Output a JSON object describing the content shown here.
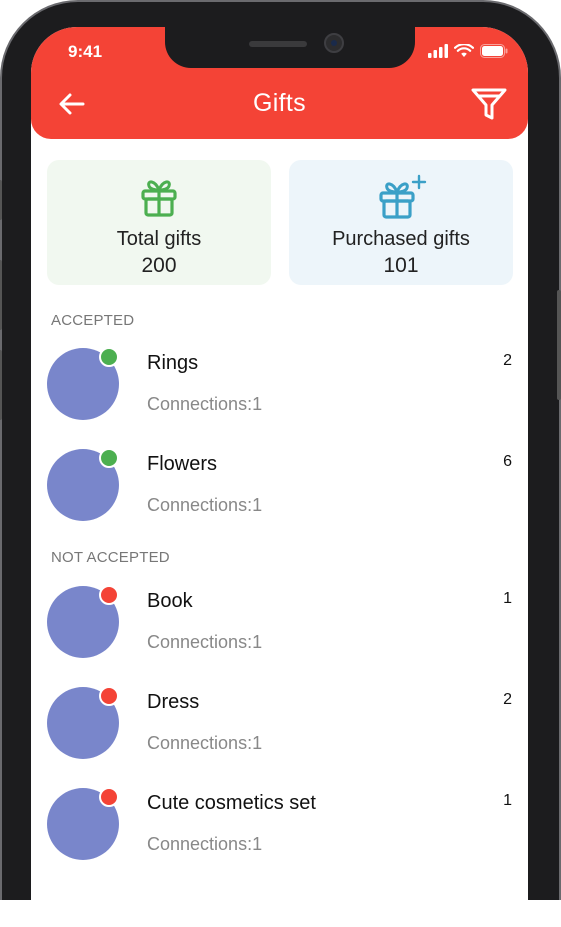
{
  "status_bar": {
    "time": "9:41"
  },
  "appbar": {
    "title": "Gifts",
    "back_icon": "arrow-left-icon",
    "filter_icon": "filter-icon",
    "color": "#f44336"
  },
  "summary": {
    "total": {
      "label": "Total gifts",
      "value": "200",
      "icon": "gift-icon",
      "color": "#4caf50"
    },
    "purchased": {
      "label": "Purchased gifts",
      "value": "101",
      "icon": "gift-plus-icon",
      "color": "#3ba0c7"
    }
  },
  "sections": {
    "accepted": {
      "header": "ACCEPTED",
      "items": [
        {
          "name": "Rings",
          "sub": "Connections:1",
          "count": "2"
        },
        {
          "name": "Flowers",
          "sub": "Connections:1",
          "count": "6"
        }
      ]
    },
    "not_accepted": {
      "header": "NOT ACCEPTED",
      "items": [
        {
          "name": "Book",
          "sub": "Connections:1",
          "count": "1"
        },
        {
          "name": "Dress",
          "sub": "Connections:1",
          "count": "2"
        },
        {
          "name": "Cute cosmetics set",
          "sub": "Connections:1",
          "count": "1"
        }
      ]
    }
  },
  "colors": {
    "accepted_dot": "#4caf50",
    "not_accepted_dot": "#f44336",
    "avatar": "#7986cb"
  }
}
